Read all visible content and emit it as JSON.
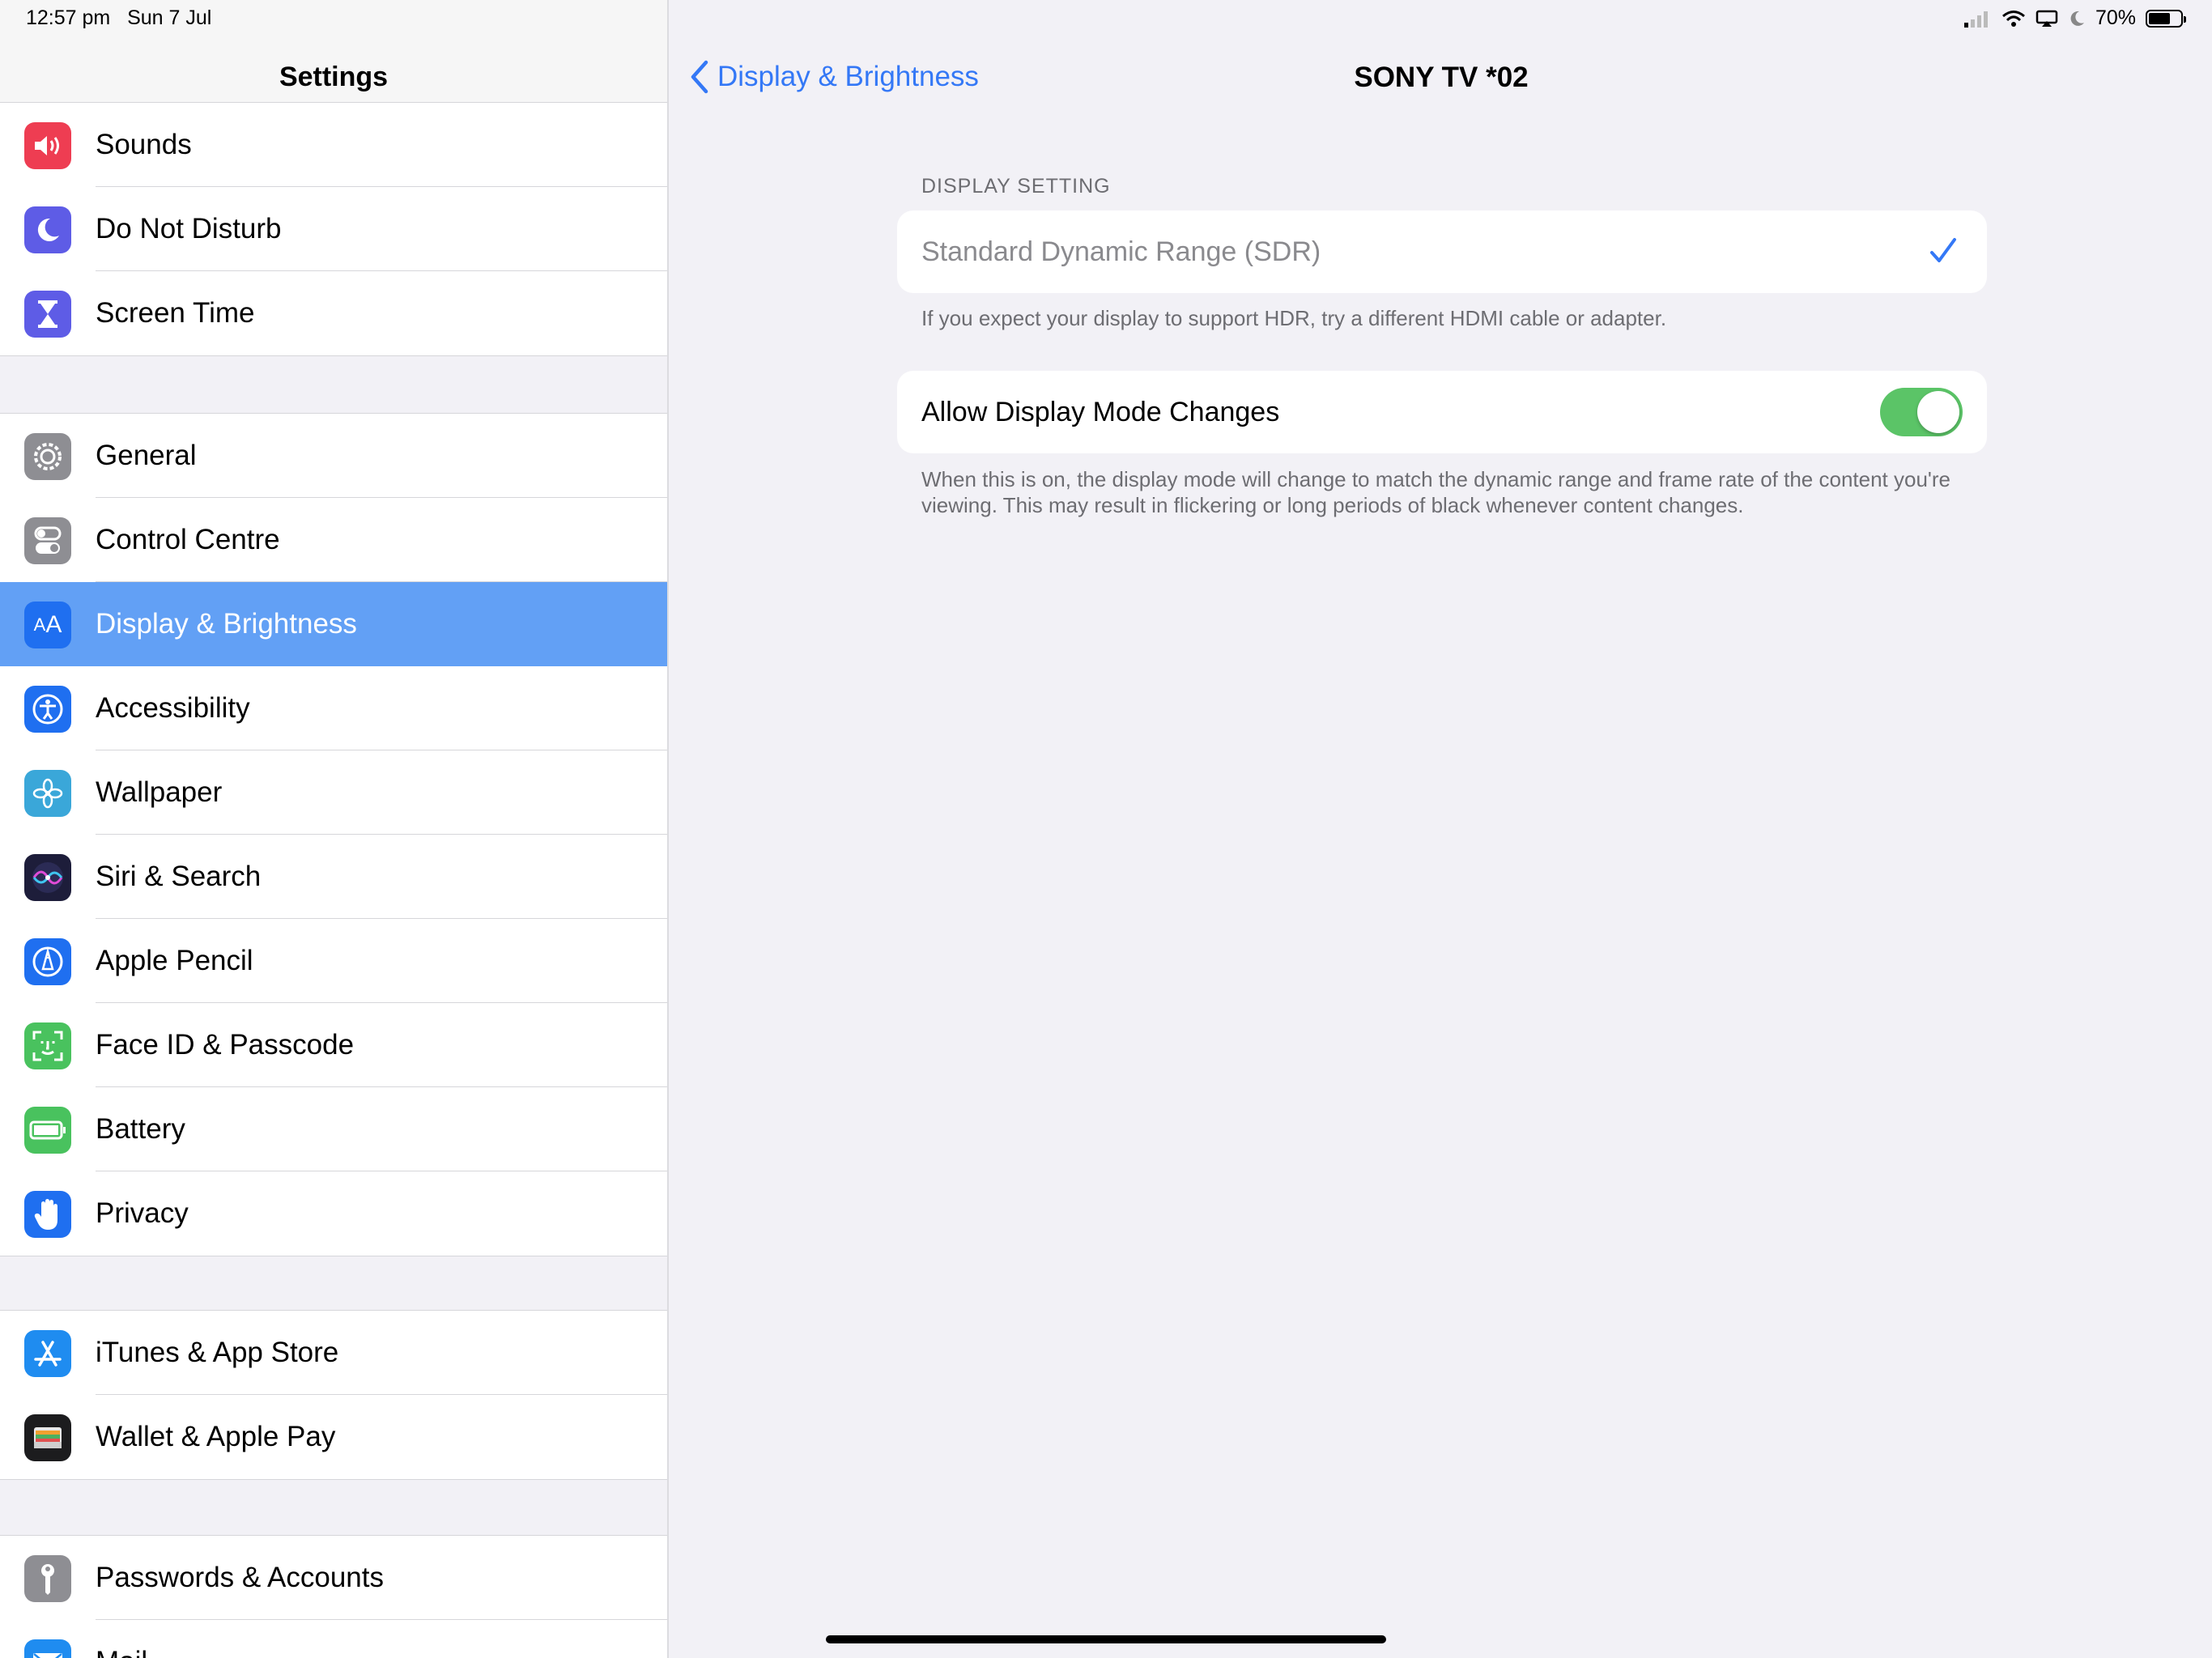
{
  "status_bar": {
    "time": "12:57 pm",
    "date": "Sun 7 Jul",
    "battery": "70%",
    "battery_level": 0.7
  },
  "sidebar": {
    "title": "Settings",
    "groups": [
      {
        "items": [
          {
            "label": "Sounds",
            "icon": "speaker-icon",
            "color": "#ee3d52"
          },
          {
            "label": "Do Not Disturb",
            "icon": "moon-icon",
            "color": "#5e5ce6"
          },
          {
            "label": "Screen Time",
            "icon": "hourglass-icon",
            "color": "#5e5ce6"
          }
        ]
      },
      {
        "items": [
          {
            "label": "General",
            "icon": "gear-icon",
            "color": "#8e8e93"
          },
          {
            "label": "Control Centre",
            "icon": "toggles-icon",
            "color": "#8e8e93"
          },
          {
            "label": "Display & Brightness",
            "icon": "display-icon",
            "color": "#1f6ff0",
            "selected": true
          },
          {
            "label": "Accessibility",
            "icon": "accessibility-icon",
            "color": "#1f6ff0"
          },
          {
            "label": "Wallpaper",
            "icon": "flower-icon",
            "color": "#3aa7d9"
          },
          {
            "label": "Siri & Search",
            "icon": "siri-icon",
            "color": "#1d1d3a"
          },
          {
            "label": "Apple Pencil",
            "icon": "pencil-icon",
            "color": "#1f6ff0"
          },
          {
            "label": "Face ID & Passcode",
            "icon": "faceid-icon",
            "color": "#49c25e"
          },
          {
            "label": "Battery",
            "icon": "battery-icon",
            "color": "#49c25e"
          },
          {
            "label": "Privacy",
            "icon": "hand-icon",
            "color": "#1f6ff0"
          }
        ]
      },
      {
        "items": [
          {
            "label": "iTunes & App Store",
            "icon": "appstore-icon",
            "color": "#1f8cf0"
          },
          {
            "label": "Wallet & Apple Pay",
            "icon": "wallet-icon",
            "color": "#1c1c1e"
          }
        ]
      },
      {
        "items": [
          {
            "label": "Passwords & Accounts",
            "icon": "key-icon",
            "color": "#8e8e93"
          },
          {
            "label": "Mail",
            "icon": "mail-icon",
            "color": "#1f8cf0"
          }
        ]
      }
    ]
  },
  "detail": {
    "back_label": "Display & Brightness",
    "title": "SONY TV  *02",
    "section_header": "DISPLAY SETTING",
    "sdr_label": "Standard Dynamic Range (SDR)",
    "sdr_footer": "If you expect your display to support HDR, try a different HDMI cable or adapter.",
    "mode_label": "Allow Display Mode Changes",
    "mode_on": true,
    "mode_footer": "When this is on, the display mode will change to match the dynamic range and frame rate of the content you're viewing. This may result in flickering or long periods of black whenever content changes."
  }
}
